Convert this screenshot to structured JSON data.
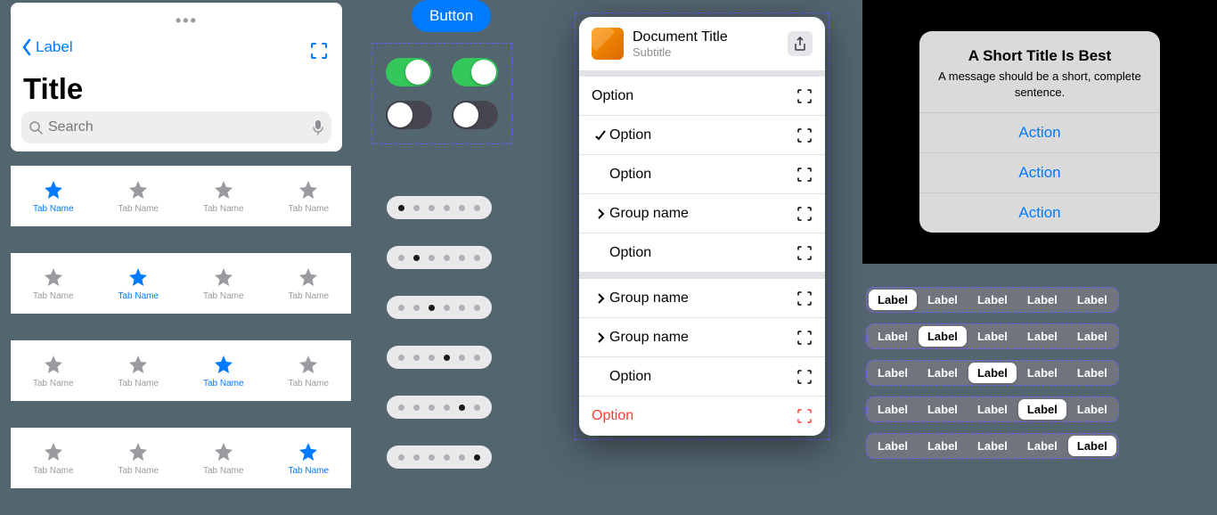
{
  "nav": {
    "back_label": "Label",
    "title": "Title",
    "search_placeholder": "Search"
  },
  "tabbars": [
    {
      "active_index": 0,
      "tabs": [
        "Tab Name",
        "Tab Name",
        "Tab Name",
        "Tab Name"
      ]
    },
    {
      "active_index": 1,
      "tabs": [
        "Tab Name",
        "Tab Name",
        "Tab Name",
        "Tab Name"
      ]
    },
    {
      "active_index": 2,
      "tabs": [
        "Tab Name",
        "Tab Name",
        "Tab Name",
        "Tab Name"
      ]
    },
    {
      "active_index": 3,
      "tabs": [
        "Tab Name",
        "Tab Name",
        "Tab Name",
        "Tab Name"
      ]
    }
  ],
  "button_label": "Button",
  "switches": [
    true,
    true,
    false,
    false
  ],
  "pagers": [
    {
      "count": 6,
      "index": 0
    },
    {
      "count": 6,
      "index": 1
    },
    {
      "count": 6,
      "index": 2
    },
    {
      "count": 6,
      "index": 3
    },
    {
      "count": 6,
      "index": 4
    },
    {
      "count": 6,
      "index": 5
    }
  ],
  "menu": {
    "title": "Document Title",
    "subtitle": "Subtitle",
    "sections": [
      [
        {
          "label": "Option",
          "lead": "none"
        },
        {
          "label": "Option",
          "lead": "check"
        },
        {
          "label": "Option",
          "lead": "indent"
        },
        {
          "label": "Group name",
          "lead": "chevron"
        },
        {
          "label": "Option",
          "lead": "indent"
        }
      ],
      [
        {
          "label": "Group name",
          "lead": "chevron"
        },
        {
          "label": "Group name",
          "lead": "chevron"
        },
        {
          "label": "Option",
          "lead": "indent"
        },
        {
          "label": "Option",
          "lead": "none",
          "danger": true
        }
      ]
    ]
  },
  "alert": {
    "title": "A Short Title Is Best",
    "message": "A message should be a short, complete sentence.",
    "actions": [
      "Action",
      "Action",
      "Action"
    ]
  },
  "segments": {
    "labels": [
      "Label",
      "Label",
      "Label",
      "Label",
      "Label"
    ],
    "rows": [
      0,
      1,
      2,
      3,
      4
    ]
  }
}
